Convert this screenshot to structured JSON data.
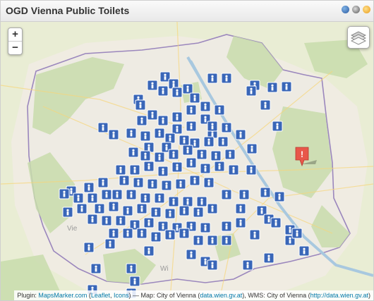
{
  "title": "OGD Vienna Public Toilets",
  "header_icons": [
    "globe-icon",
    "kml-icon",
    "rss-icon"
  ],
  "controls": {
    "zoom_in": "+",
    "zoom_out": "−",
    "layers_icon": "layers-icon"
  },
  "map_labels": {
    "west": "Vie",
    "south": "Wi"
  },
  "attribution": {
    "plugin": "Plugin:",
    "mapsmarker": "MapsMarker.com",
    "leaflet": "Leaflet",
    "icons": "Icons",
    "map": "— Map: City of Vienna",
    "data_wien": "data.wien.gv.at",
    "wms": "WMS: City of Vienna",
    "data_wien_url": "http://data.wien.gv.at"
  },
  "colors": {
    "marker": "#3966b8",
    "alert_marker": "#e8574a",
    "park": "#c8dcab",
    "boundary": "#9b87bd",
    "river": "#a8c8df"
  },
  "marker_icons": [
    "wheelchair-toilet-icon",
    "toilet-icon",
    "baby-changing-icon"
  ]
}
